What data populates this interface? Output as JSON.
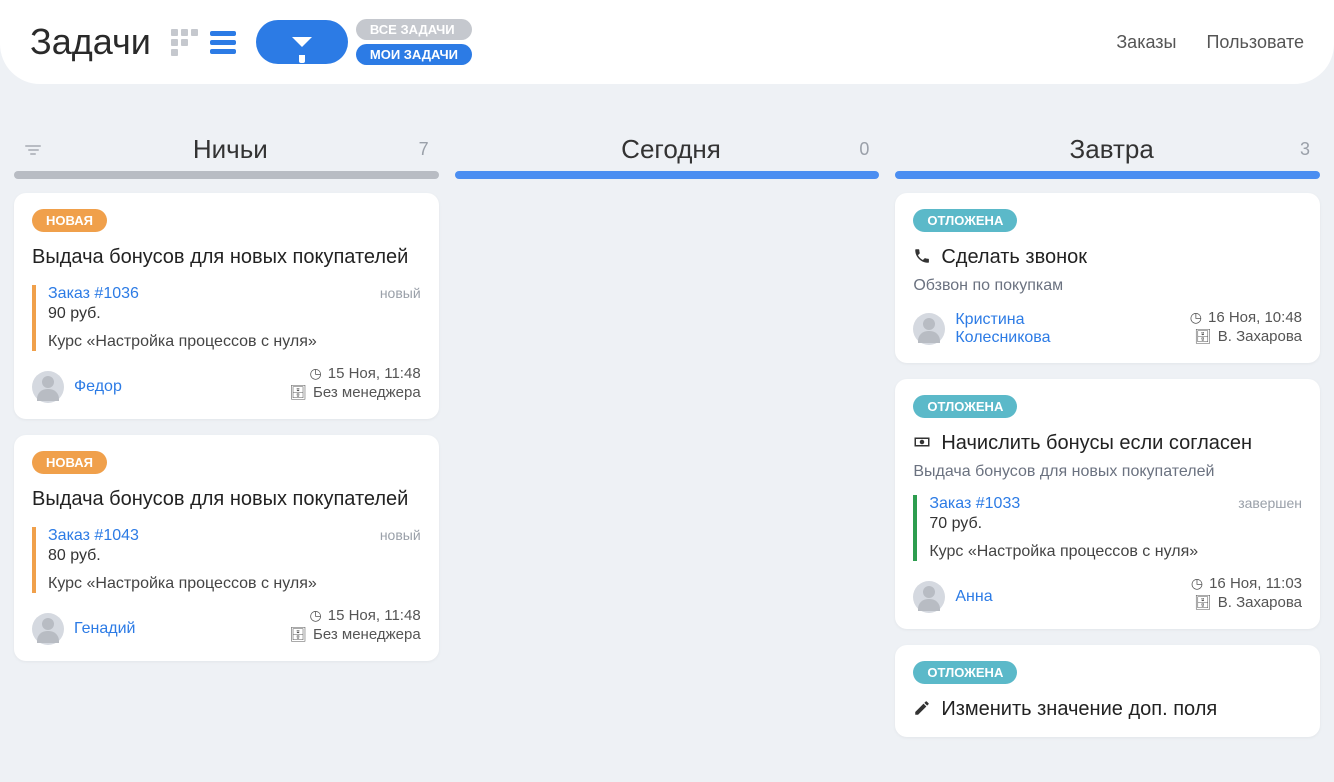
{
  "header": {
    "title": "Задачи",
    "filter_all": "ВСЕ ЗАДАЧИ",
    "filter_my": "МОИ ЗАДАЧИ",
    "nav_orders": "Заказы",
    "nav_users": "Пользовате"
  },
  "columns": [
    {
      "title": "Ничьи",
      "count": "7",
      "bar": "gray"
    },
    {
      "title": "Сегодня",
      "count": "0",
      "bar": "blue"
    },
    {
      "title": "Завтра",
      "count": "3",
      "bar": "blue"
    }
  ],
  "col0": {
    "card0": {
      "badge": "НОВАЯ",
      "title": "Выдача бонусов для новых покупателей",
      "order_link": "Заказ #1036",
      "order_status": "новый",
      "price": "90 руб.",
      "product": "Курс «Настройка процессов с нуля»",
      "user": "Федор",
      "time": "15 Ноя, 11:48",
      "manager": "Без менеджера"
    },
    "card1": {
      "badge": "НОВАЯ",
      "title": "Выдача бонусов для новых покупателей",
      "order_link": "Заказ #1043",
      "order_status": "новый",
      "price": "80 руб.",
      "product": "Курс «Настройка процессов с нуля»",
      "user": "Генадий",
      "time": "15 Ноя, 11:48",
      "manager": "Без менеджера"
    }
  },
  "col2": {
    "card0": {
      "badge": "ОТЛОЖЕНА",
      "title": "Сделать звонок",
      "subtitle": "Обзвон по покупкам",
      "user": "Кристина Колесникова",
      "time": "16 Ноя, 10:48",
      "manager": "В. Захарова"
    },
    "card1": {
      "badge": "ОТЛОЖЕНА",
      "title": "Начислить бонусы если согласен",
      "subtitle": "Выдача бонусов для новых покупателей",
      "order_link": "Заказ #1033",
      "order_status": "завершен",
      "price": "70 руб.",
      "product": "Курс «Настройка процессов с нуля»",
      "user": "Анна",
      "time": "16 Ноя, 11:03",
      "manager": "В. Захарова"
    },
    "card2": {
      "badge": "ОТЛОЖЕНА",
      "title": "Изменить значение доп. поля"
    }
  }
}
